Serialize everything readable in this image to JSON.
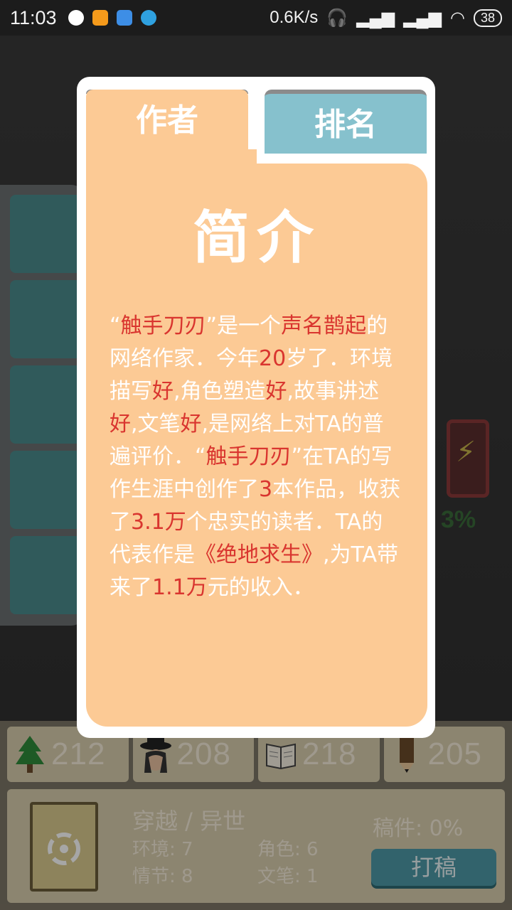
{
  "status_bar": {
    "time": "11:03",
    "net_speed": "0.6K/s",
    "battery": "38"
  },
  "background": {
    "battery_percent": "3%"
  },
  "stats": [
    {
      "icon": "tree-icon",
      "value": "212"
    },
    {
      "icon": "hat-character-icon",
      "value": "208"
    },
    {
      "icon": "book-open-icon",
      "value": "218"
    },
    {
      "icon": "pencil-icon",
      "value": "205"
    }
  ],
  "info": {
    "genre": "穿越 / 异世",
    "env_label": "环境: 7",
    "role_label": "角色: 6",
    "plot_label": "情节: 8",
    "writing_label": "文笔: 1",
    "draft_label": "稿件: 0%",
    "draft_button": "打稿"
  },
  "modal": {
    "tab_author": "作者",
    "tab_rank": "排名",
    "title": "简介",
    "description": [
      {
        "t": "“",
        "hl": false
      },
      {
        "t": "触手刀刃",
        "hl": true
      },
      {
        "t": "”是一个",
        "hl": false
      },
      {
        "t": "声名鹊起",
        "hl": true
      },
      {
        "t": "的网络作家．今年",
        "hl": false
      },
      {
        "t": "20",
        "hl": true
      },
      {
        "t": "岁了．环境描写",
        "hl": false
      },
      {
        "t": "好",
        "hl": true
      },
      {
        "t": ",角色塑造",
        "hl": false
      },
      {
        "t": "好",
        "hl": true
      },
      {
        "t": ",故事讲述",
        "hl": false
      },
      {
        "t": "好",
        "hl": true
      },
      {
        "t": ",文笔",
        "hl": false
      },
      {
        "t": "好",
        "hl": true
      },
      {
        "t": ",是网络上对TA的普遍评价．“",
        "hl": false
      },
      {
        "t": "触手刀刃",
        "hl": true
      },
      {
        "t": "”在TA的写作生涯中创作了",
        "hl": false
      },
      {
        "t": "3",
        "hl": true
      },
      {
        "t": "本作品，收获了",
        "hl": false
      },
      {
        "t": "3.1万",
        "hl": true
      },
      {
        "t": "个忠实的读者．TA的代表作是",
        "hl": false
      },
      {
        "t": "《绝地求生》",
        "hl": true
      },
      {
        "t": ",为TA带来了",
        "hl": false
      },
      {
        "t": "1.1万",
        "hl": true
      },
      {
        "t": "元的收入．",
        "hl": false
      }
    ]
  },
  "colors": {
    "card": "#fcca95",
    "tab_rank": "#86c1cd",
    "highlight": "#d9352f",
    "panel": "#d8ccad",
    "button": "#4e99a6"
  }
}
